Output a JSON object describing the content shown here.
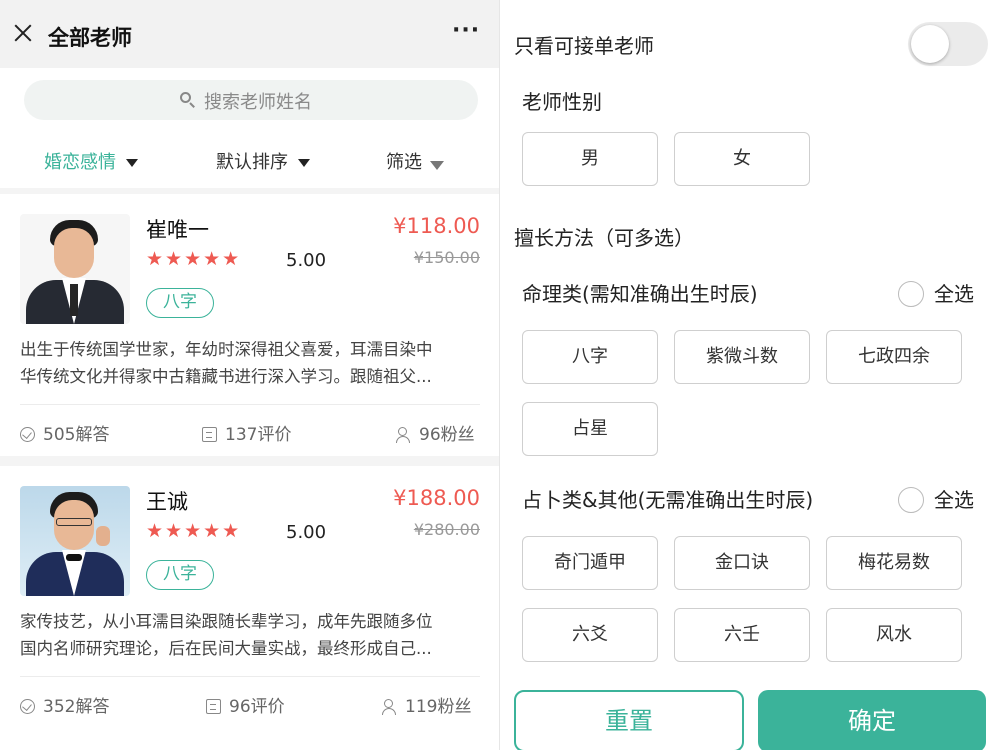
{
  "left": {
    "header": {
      "title": "全部老师",
      "more": "···"
    },
    "search": {
      "placeholder": "搜索老师姓名"
    },
    "filters": [
      {
        "label": "婚恋感情",
        "active": true
      },
      {
        "label": "默认排序",
        "active": false
      },
      {
        "label": "筛选",
        "active": false
      }
    ],
    "teachers": [
      {
        "name": "崔唯一",
        "stars": "★★★★★",
        "rating": "5.00",
        "tag": "八字",
        "price": "¥118.00",
        "old_price": "¥150.00",
        "desc_line1": "出生于传统国学世家，年幼时深得祖父喜爱，耳濡目染中",
        "desc_line2": "华传统文化并得家中古籍藏书进行深入学习。跟随祖父...",
        "answers": "505解答",
        "reviews": "137评价",
        "fans": "96粉丝"
      },
      {
        "name": "王诚",
        "stars": "★★★★★",
        "rating": "5.00",
        "tag": "八字",
        "price": "¥188.00",
        "old_price": "¥280.00",
        "desc_line1": "家传技艺，从小耳濡目染跟随长辈学习，成年先跟随多位",
        "desc_line2": "国内名师研究理论，后在民间大量实战，最终形成自己...",
        "answers": "352解答",
        "reviews": "96评价",
        "fans": "119粉丝"
      }
    ]
  },
  "right": {
    "only_available_label": "只看可接单老师",
    "only_available_on": false,
    "gender_title": "老师性别",
    "gender_options": [
      "男",
      "女"
    ],
    "methods_title": "擅长方法（可多选）",
    "group1_title": "命理类(需知准确出生时辰)",
    "group1_select_all": "全选",
    "group1_options": [
      "八字",
      "紫微斗数",
      "七政四余",
      "占星"
    ],
    "group2_title": "占卜类&其他(无需准确出生时辰)",
    "group2_select_all": "全选",
    "group2_options": [
      "奇门遁甲",
      "金口诀",
      "梅花易数",
      "六爻",
      "六壬",
      "风水"
    ],
    "reset_label": "重置",
    "confirm_label": "确定"
  },
  "colors": {
    "accent": "#3bb39a",
    "price": "#ee5a52",
    "star": "#ee5a52"
  }
}
